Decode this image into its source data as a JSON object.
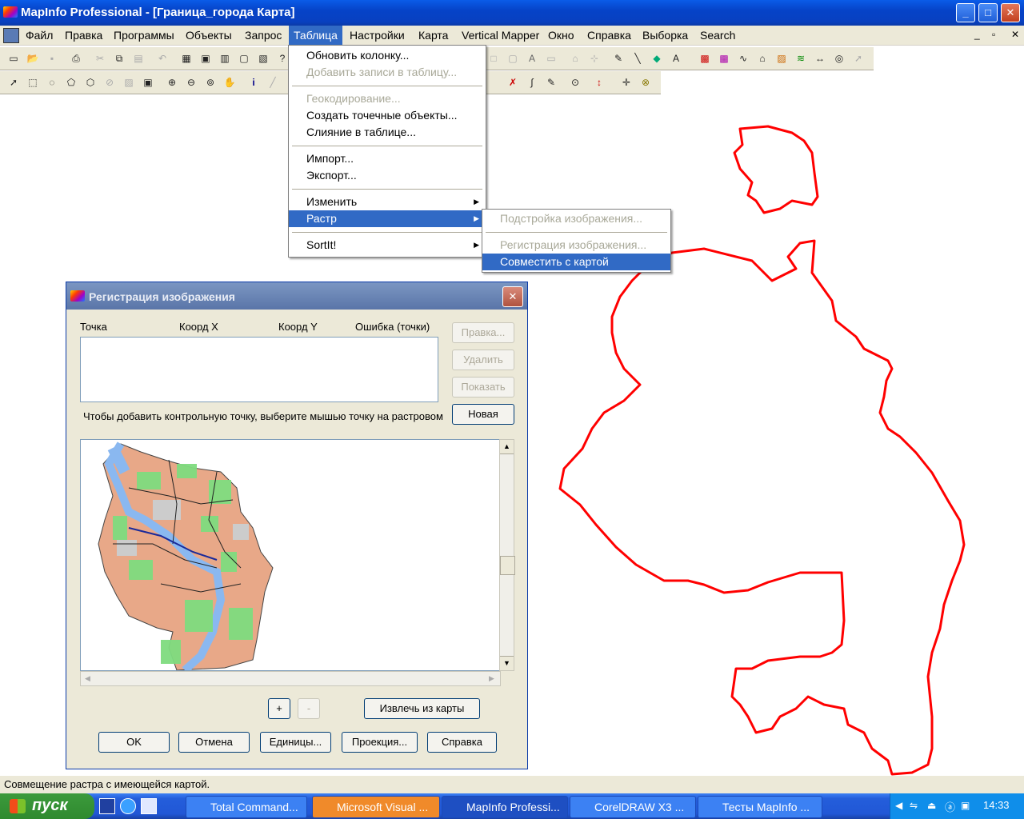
{
  "window": {
    "title": "MapInfo Professional - [Граница_города Карта]",
    "min_label": "_",
    "max_label": "□",
    "close_label": "✕"
  },
  "menubar": [
    "Файл",
    "Правка",
    "Программы",
    "Объекты",
    "Запрос",
    "Таблица",
    "Настройки",
    "Карта",
    "Vertical Mapper",
    "Окно",
    "Справка",
    "Выборка",
    "Search"
  ],
  "menubar_active": "Таблица",
  "table_menu": {
    "items": [
      {
        "label": "Обновить колонку...",
        "enabled": true
      },
      {
        "label": "Добавить записи в таблицу...",
        "enabled": false
      },
      {
        "label": "Геокодирование...",
        "enabled": false
      },
      {
        "label": "Создать точечные объекты...",
        "enabled": true
      },
      {
        "label": "Слияние в таблице...",
        "enabled": true
      },
      {
        "label": "Импорт...",
        "enabled": true
      },
      {
        "label": "Экспорт...",
        "enabled": true
      },
      {
        "label": "Изменить",
        "enabled": true,
        "submenu": true
      },
      {
        "label": "Растр",
        "enabled": true,
        "submenu": true,
        "highlighted": true
      },
      {
        "label": "SortIt!",
        "enabled": true,
        "submenu": true
      }
    ]
  },
  "raster_submenu": {
    "items": [
      {
        "label": "Подстройка изображения...",
        "enabled": false
      },
      {
        "label": "Регистрация изображения...",
        "enabled": false
      },
      {
        "label": "Совместить с картой",
        "enabled": true,
        "highlighted": true
      }
    ]
  },
  "dialog": {
    "title": "Регистрация изображения",
    "columns": [
      "Точка",
      "Коорд X",
      "Коорд Y",
      "Ошибка (точки)"
    ],
    "side_buttons": {
      "edit": "Правка...",
      "delete": "Удалить",
      "show": "Показать",
      "new": "Новая"
    },
    "hint": "Чтобы добавить контрольную точку, выберите мышью точку на растровом",
    "zoom_in": "+",
    "zoom_out": "-",
    "extract": "Извлечь из карты",
    "buttons": {
      "ok": "OK",
      "cancel": "Отмена",
      "units": "Единицы...",
      "projection": "Проекция...",
      "help": "Справка"
    }
  },
  "status": "Совмещение растра с имеющейся картой.",
  "taskbar": {
    "start": "пуск",
    "tasks": [
      "Total Command...",
      "Microsoft Visual ...",
      "MapInfo Professi...",
      "CorelDRAW X3 ...",
      "Тесты MapInfo ..."
    ],
    "clock": "14:33"
  },
  "colors": {
    "boundary": "#ff0000",
    "menu_highlight": "#316ac5",
    "xp_blue": "#0a5ce8"
  }
}
